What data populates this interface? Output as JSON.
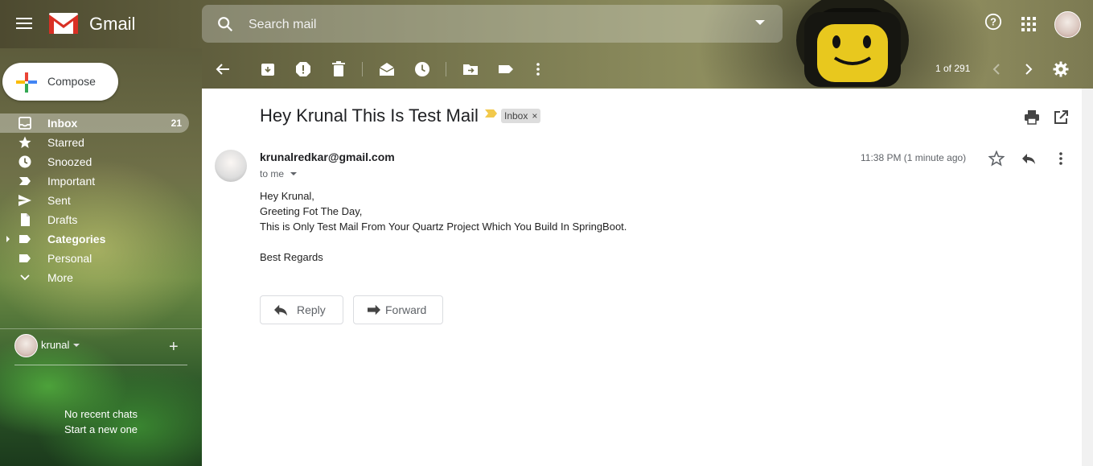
{
  "app": {
    "name": "Gmail"
  },
  "search": {
    "placeholder": "Search mail"
  },
  "compose": {
    "label": "Compose"
  },
  "nav": {
    "items": [
      {
        "label": "Inbox",
        "count": "21",
        "icon": "inbox-icon",
        "active": true
      },
      {
        "label": "Starred",
        "icon": "star-icon"
      },
      {
        "label": "Snoozed",
        "icon": "clock-icon"
      },
      {
        "label": "Important",
        "icon": "important-icon"
      },
      {
        "label": "Sent",
        "icon": "send-icon"
      },
      {
        "label": "Drafts",
        "icon": "draft-icon"
      },
      {
        "label": "Categories",
        "icon": "label-icon",
        "expandable": true
      },
      {
        "label": "Personal",
        "icon": "label-icon"
      },
      {
        "label": "More",
        "icon": "chevron-down-icon"
      }
    ]
  },
  "hangouts": {
    "user": "krunal",
    "no_chats": "No recent chats",
    "start": "Start a new one"
  },
  "toolbar": {
    "pager": "1 of 291"
  },
  "mail": {
    "subject": "Hey Krunal This Is Test Mail",
    "label": "Inbox",
    "sender": "krunalredkar@gmail.com",
    "to": "to me",
    "time": "11:38 PM (1 minute ago)",
    "body": [
      "Hey Krunal,",
      "Greeting Fot The Day,",
      "This is Only Test Mail From Your Quartz Project Which You Build In SpringBoot.",
      "",
      "Best Regards"
    ],
    "reply_label": "Reply",
    "forward_label": "Forward"
  },
  "colors": {
    "accent_red": "#d93025",
    "important_yellow": "#f2c94c"
  }
}
